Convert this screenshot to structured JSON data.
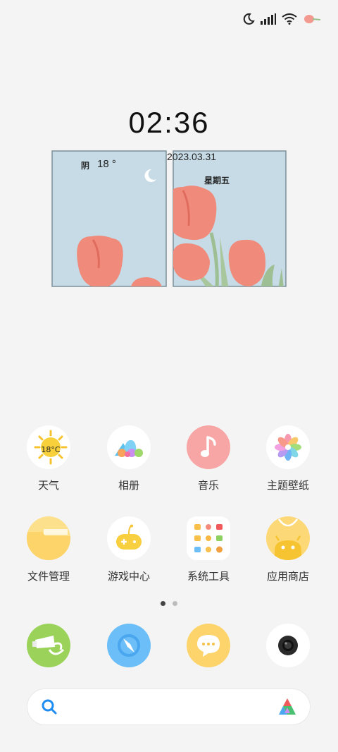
{
  "status_bar": {
    "icons": [
      "moon-icon",
      "signal-icon",
      "wifi-icon",
      "tulip-icon"
    ]
  },
  "clock": {
    "time": "02:36"
  },
  "widget": {
    "date": "2023.03.31",
    "weather_condition": "阴",
    "temperature": "18 °",
    "weekday": "星期五"
  },
  "apps": [
    {
      "label": "天气",
      "icon": "weather-icon",
      "badge": "18°C",
      "color": "#ffffff"
    },
    {
      "label": "相册",
      "icon": "gallery-icon",
      "color": "#ffffff"
    },
    {
      "label": "音乐",
      "icon": "music-note-icon",
      "color": "#f8a5a5"
    },
    {
      "label": "主题壁纸",
      "icon": "theme-flower-icon",
      "color": "#ffffff"
    },
    {
      "label": "文件管理",
      "icon": "folder-icon",
      "color": "#fde08b"
    },
    {
      "label": "游戏中心",
      "icon": "game-controller-icon",
      "color": "#ffffff"
    },
    {
      "label": "系统工具",
      "icon": "tools-folder-icon",
      "color": "#ffffff"
    },
    {
      "label": "应用商店",
      "icon": "app-store-icon",
      "color": "#fdd877"
    }
  ],
  "page_indicator": {
    "pages": 2,
    "active": 0
  },
  "dock": [
    {
      "icon": "phone-icon",
      "color": "#9bd35a"
    },
    {
      "icon": "browser-compass-icon",
      "color": "#6bbef7"
    },
    {
      "icon": "messages-icon",
      "color": "#fdd46b"
    },
    {
      "icon": "camera-icon",
      "color": "#ffffff"
    }
  ],
  "search": {
    "icons": [
      "search-icon",
      "assistant-logo-icon"
    ]
  }
}
